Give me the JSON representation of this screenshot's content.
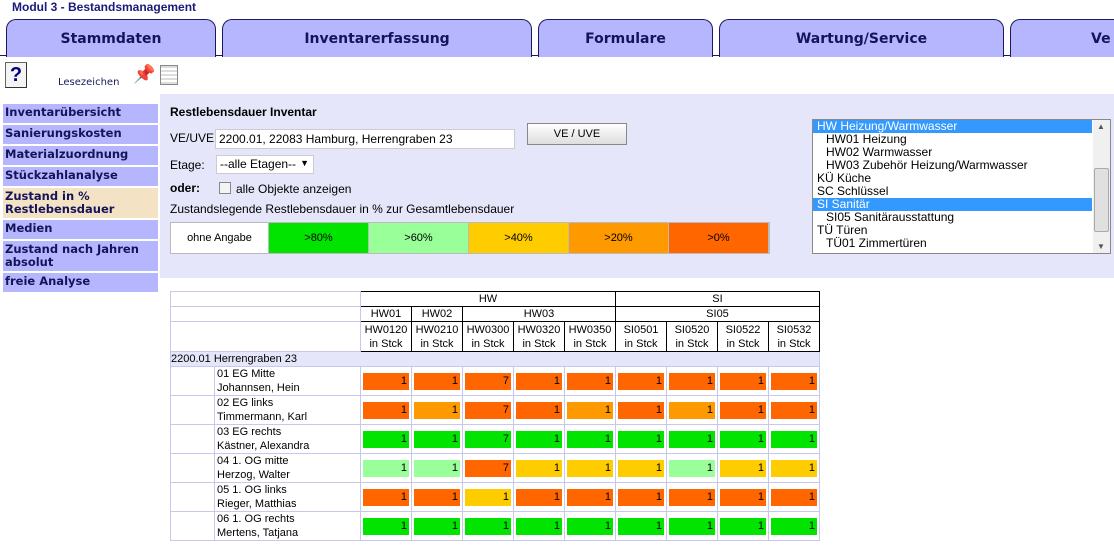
{
  "app_title": "Modul 3 - Bestandsmanagement",
  "tabs": [
    "Stammdaten",
    "Inventarerfassung",
    "Formulare",
    "Wartung/Service",
    "Ve"
  ],
  "toolbar": {
    "help": "?",
    "bookmarks": "Lesezeichen"
  },
  "sidebar": [
    {
      "label": "Inventarübersicht",
      "active": false
    },
    {
      "label": "Sanierungskosten",
      "active": false
    },
    {
      "label": "Materialzuordnung",
      "active": false
    },
    {
      "label": "Stückzahlanalyse",
      "active": false
    },
    {
      "label": "Zustand in % Restlebensdauer",
      "active": true
    },
    {
      "label": "Medien",
      "active": false
    },
    {
      "label": "Zustand nach Jahren absolut",
      "active": false
    },
    {
      "label": "freie Analyse",
      "active": false
    }
  ],
  "form": {
    "title": "Restlebensdauer Inventar",
    "ve_label": "VE/UVE:",
    "ve_value": "2200.01, 22083 Hamburg, Herrengraben 23",
    "ve_button": "VE / UVE",
    "etage_label": "Etage:",
    "etage_value": "--alle Etagen--",
    "oder_label": "oder:",
    "all_objects_label": "alle Objekte anzeigen",
    "all_objects_checked": false,
    "legend_title": "Zustandslegende Restlebensdauer in % zur Gesamtlebensdauer"
  },
  "colors": {
    "none": "#ffffff",
    "G": "#00e400",
    "L": "#99ff99",
    "Y": "#ffcc00",
    "O": "#ff9900",
    "R": "#ff6600"
  },
  "legend": [
    {
      "key": "none",
      "label": "ohne Angabe"
    },
    {
      "key": "G",
      "label": ">80%"
    },
    {
      "key": "L",
      "label": ">60%"
    },
    {
      "key": "Y",
      "label": ">40%"
    },
    {
      "key": "O",
      "label": ">20%"
    },
    {
      "key": "R",
      "label": ">0%"
    }
  ],
  "listbox": [
    {
      "label": "HW Heizung/Warmwasser",
      "sub": false,
      "selected": true
    },
    {
      "label": "HW01 Heizung",
      "sub": true,
      "selected": false
    },
    {
      "label": "HW02 Warmwasser",
      "sub": true,
      "selected": false
    },
    {
      "label": "HW03 Zubehör Heizung/Warmwasser",
      "sub": true,
      "selected": false
    },
    {
      "label": "KÜ Küche",
      "sub": false,
      "selected": false
    },
    {
      "label": "SC Schlüssel",
      "sub": false,
      "selected": false
    },
    {
      "label": "SI Sanitär",
      "sub": false,
      "selected": true
    },
    {
      "label": "SI05 Sanitärausstattung",
      "sub": true,
      "selected": false
    },
    {
      "label": "TÜ Türen",
      "sub": false,
      "selected": false
    },
    {
      "label": "TÜ01 Zimmertüren",
      "sub": true,
      "selected": false
    }
  ],
  "table": {
    "groups": [
      {
        "label": "HW",
        "span": 5
      },
      {
        "label": "SI",
        "span": 4
      }
    ],
    "subgroups": [
      {
        "label": "HW01",
        "span": 1
      },
      {
        "label": "HW02",
        "span": 1
      },
      {
        "label": "HW03",
        "span": 3
      },
      {
        "label": "SI05",
        "span": 4
      }
    ],
    "columns": [
      "HW0120",
      "HW0210",
      "HW0300",
      "HW0320",
      "HW0350",
      "SI0501",
      "SI0520",
      "SI0522",
      "SI0532"
    ],
    "unit": "in Stck",
    "building": "2200.01 Herrengraben 23",
    "rows": [
      {
        "unit": "01 EG Mitte",
        "tenant": "Johannsen, Hein",
        "values": [
          1,
          1,
          7,
          1,
          1,
          1,
          1,
          1,
          1
        ],
        "states": [
          "R",
          "R",
          "R",
          "R",
          "R",
          "R",
          "R",
          "R",
          "R"
        ]
      },
      {
        "unit": "02 EG links",
        "tenant": "Timmermann, Karl",
        "values": [
          1,
          1,
          7,
          1,
          1,
          1,
          1,
          1,
          1
        ],
        "states": [
          "R",
          "O",
          "R",
          "R",
          "O",
          "R",
          "O",
          "R",
          "R"
        ]
      },
      {
        "unit": "03 EG rechts",
        "tenant": "Kästner, Alexandra",
        "values": [
          1,
          1,
          7,
          1,
          1,
          1,
          1,
          1,
          1
        ],
        "states": [
          "G",
          "G",
          "G",
          "G",
          "G",
          "G",
          "G",
          "G",
          "G"
        ]
      },
      {
        "unit": "04 1. OG mitte",
        "tenant": "Herzog, Walter",
        "values": [
          1,
          1,
          7,
          1,
          1,
          1,
          1,
          1,
          1
        ],
        "states": [
          "L",
          "L",
          "R",
          "Y",
          "Y",
          "Y",
          "L",
          "Y",
          "Y"
        ]
      },
      {
        "unit": "05 1. OG links",
        "tenant": "Rieger, Matthias",
        "values": [
          1,
          1,
          1,
          1,
          1,
          1,
          1,
          1,
          1
        ],
        "states": [
          "R",
          "R",
          "Y",
          "R",
          "R",
          "R",
          "R",
          "R",
          "R"
        ]
      },
      {
        "unit": "06 1. OG rechts",
        "tenant": "Mertens, Tatjana",
        "values": [
          1,
          1,
          1,
          1,
          1,
          1,
          1,
          1,
          1
        ],
        "states": [
          "G",
          "G",
          "G",
          "G",
          "G",
          "G",
          "G",
          "G",
          "G"
        ]
      }
    ]
  }
}
